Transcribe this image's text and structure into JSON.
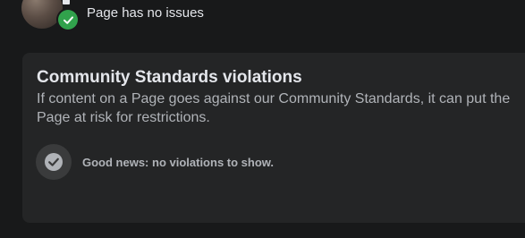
{
  "page_status": {
    "text": "Page has no issues",
    "badge_color": "#31a24c",
    "icon": "check-icon"
  },
  "violations_card": {
    "title": "Community Standards violations",
    "description": "If content on a Page goes against our Community Standards, it can put the Page at risk for restrictions.",
    "result_text": "Good news: no violations to show.",
    "result_icon": "check-circle-icon"
  },
  "colors": {
    "background": "#18191a",
    "card": "#242526",
    "primary_text": "#e4e6eb",
    "secondary_text": "#b0b3b8",
    "success": "#31a24c"
  }
}
